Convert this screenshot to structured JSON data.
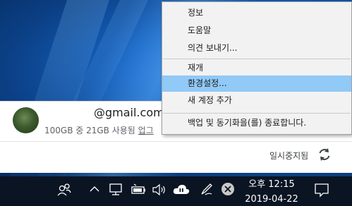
{
  "menu": {
    "items": [
      {
        "label": "정보"
      },
      {
        "label": "도움말"
      },
      {
        "label": "의견 보내기..."
      },
      {
        "label": "재개"
      },
      {
        "label": "환경설정..."
      },
      {
        "label": "새 계정 추가"
      },
      {
        "label": "백업 및 동기화을(를) 종료합니다."
      }
    ],
    "selected_index": 4
  },
  "account": {
    "email": "@gmail.com",
    "storage_text": "100GB 중 21GB 사용됨",
    "upgrade_label": "업그"
  },
  "status": {
    "paused_label": "일시중지됨"
  },
  "clock": {
    "time": "오후 12:15",
    "date": "2019-04-22"
  },
  "colors": {
    "menu_highlight": "#91c9f7",
    "taskbar": "#0b1423"
  }
}
